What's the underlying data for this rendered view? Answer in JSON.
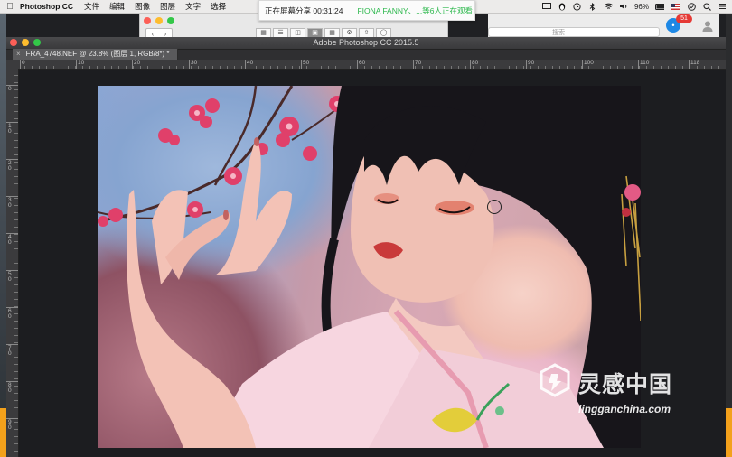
{
  "menubar": {
    "apple_icon": "apple-icon",
    "app_name": "Photoshop CC",
    "items": [
      "文件",
      "编辑",
      "图像",
      "图层",
      "文字",
      "选择"
    ],
    "battery": "96%"
  },
  "share_toast": {
    "timer_label": "正在屏幕分享 00:31:24",
    "viewer_text": "FIONA FANNY、...等6人正在观看"
  },
  "finder": {
    "title": "..."
  },
  "right_window": {
    "search_placeholder": "搜索",
    "unread_badge": "51"
  },
  "photoshop": {
    "window_title": "Adobe Photoshop CC 2015.5",
    "doc_tab": "FRA_4748.NEF @ 23.8% (图层 1, RGB/8*) *",
    "hruler_labels": [
      "0",
      "10",
      "20",
      "30",
      "40",
      "50",
      "60",
      "70",
      "80",
      "90",
      "100",
      "110",
      "118"
    ],
    "vruler_labels": [
      "0",
      "1 0",
      "2 0",
      "3 0",
      "4 0",
      "5 0",
      "6 0",
      "7 0",
      "8 0",
      "9 0"
    ]
  },
  "watermark": {
    "logo_text": "灵感中国",
    "url": "lingganchina.com"
  },
  "colors": {
    "accent_orange": "#f3a11b",
    "close_red": "#fc5f57",
    "minimize_yellow": "#fdbc2e",
    "zoom_green": "#33c748",
    "toast_green": "#2db84d"
  }
}
